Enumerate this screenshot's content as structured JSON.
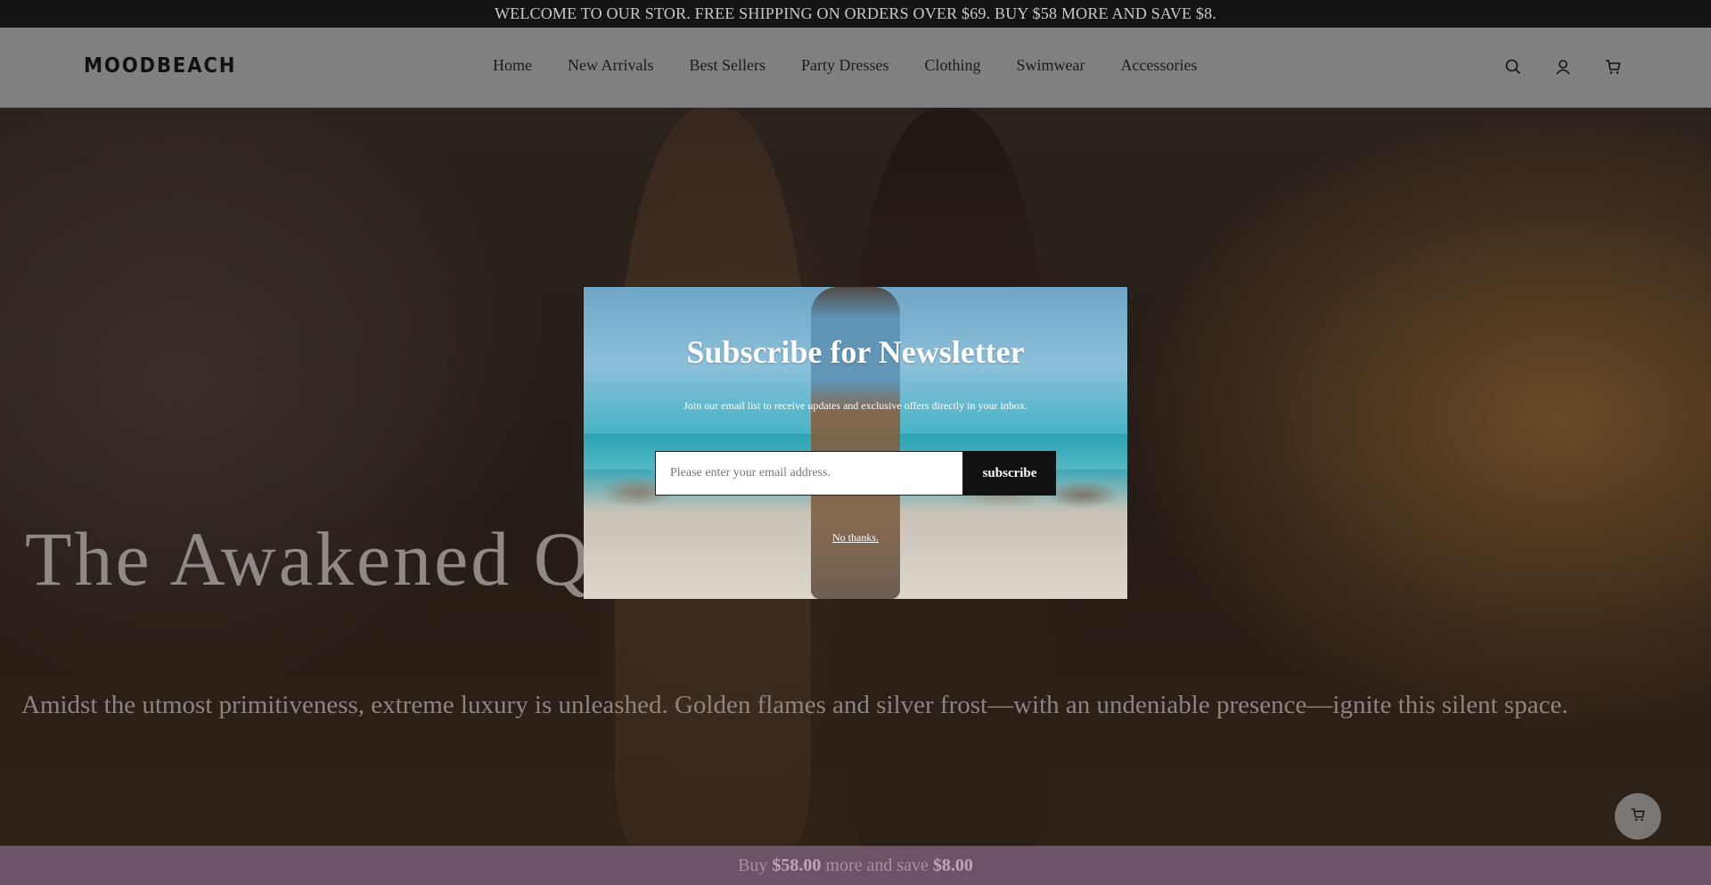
{
  "announcement": {
    "text": "WELCOME TO OUR STOR. FREE SHIPPING ON ORDERS OVER $69. BUY $58 MORE AND SAVE $8."
  },
  "header": {
    "logo": "MOODBEACH",
    "nav": [
      {
        "label": "Home"
      },
      {
        "label": "New Arrivals"
      },
      {
        "label": "Best Sellers"
      },
      {
        "label": "Party Dresses"
      },
      {
        "label": "Clothing"
      },
      {
        "label": "Swimwear"
      },
      {
        "label": "Accessories"
      }
    ],
    "icons": [
      "search-icon",
      "account-icon",
      "cart-icon"
    ]
  },
  "hero": {
    "title": "The Awakened Q",
    "subtitle": "Amidst the utmost primitiveness, extreme luxury is unleashed. Golden flames and silver frost—with an undeniable presence—ignite this silent space."
  },
  "newsletter": {
    "title": "Subscribe for Newsletter",
    "description": "Join our email list to receive updates and exclusive offers directly in your inbox.",
    "email_placeholder": "Please enter your email address.",
    "subscribe_label": "subscribe",
    "no_thanks_label": "No thanks."
  },
  "bottom_bar": {
    "prefix": "Buy",
    "amount1": "$58.00",
    "middle": "more and save",
    "amount2": "$8.00"
  },
  "colors": {
    "announcement_bg": "#141414",
    "header_bg": "#808080",
    "bottom_bar_bg": "#6d5368",
    "button_bg": "#111111"
  }
}
